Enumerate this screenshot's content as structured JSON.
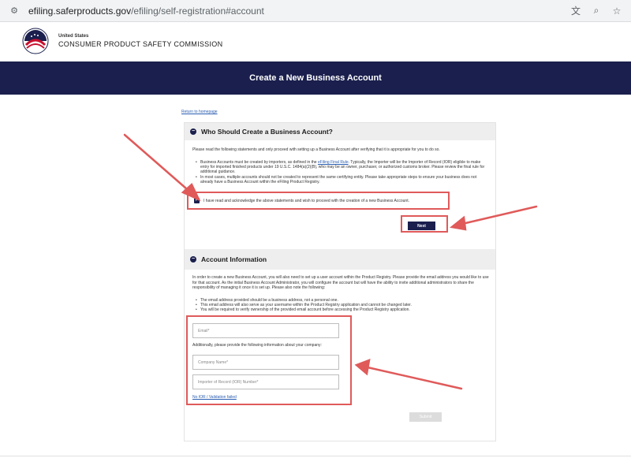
{
  "browser": {
    "url_host": "efiling.saferproducts.gov",
    "url_path": "/efiling/self-registration#account"
  },
  "header": {
    "agency_small": "United States",
    "agency_name": "CONSUMER PRODUCT SAFETY COMMISSION"
  },
  "banner": {
    "title": "Create a New Business Account"
  },
  "return_link": "Return to homepage",
  "section1": {
    "title": "Who Should Create a Business Account?",
    "intro": "Please read the following statements and only proceed with setting up a Business Account after verifying that it is appropriate for you to do so.",
    "bullet1_pre": "Business Accounts must be created by importers, as defined in the ",
    "bullet1_link": "eFiling Final Rule",
    "bullet1_post": ". Typically, the Importer will be the Importer of Record (IOR) eligible to make entry for imported finished products under 19 U.S.C. 1484(a)(2)(B), who may be an owner, purchaser, or authorized customs broker. Please review the final rule for additional guidance.",
    "bullet2": "In most cases, multiple accounts should not be created to represent the same certifying entity. Please take appropriate steps to ensure your business does not already have a Business Account within the eFiling Product Registry.",
    "ack_label": "I have read and acknowledge the above statements and wish to proceed with the creation of a new Business Account.",
    "next_label": "Next"
  },
  "section2": {
    "title": "Account Information",
    "intro": "In order to create a new Business Account, you will also need to set up a user account within the Product Registry. Please provide the email address you would like to use for that account. As the initial Business Account Administrator, you will configure the account but will have the ability to invite additional administrators to share the responsibility of managing it once it is set up. Please also note the following:",
    "bullets": [
      "The email address provided should be a business address, not a personal one.",
      "This email address will also serve as your username within the Product Registry application and cannot be changed later.",
      "You will be required to verify ownership of the provided email account before accessing the Product Registry application."
    ],
    "email_placeholder": "Email*",
    "additional_text": "Additionally, please provide the following information about your company:",
    "company_placeholder": "Company Name*",
    "ior_placeholder": "Importer of Record (IOR) Number*",
    "no_ior_link": "No IOR / Validation failed",
    "submit_label": "Submit"
  },
  "colors": {
    "navy": "#1a1f4d",
    "annotation_red": "#e05a5a",
    "link": "#2a5db0"
  }
}
